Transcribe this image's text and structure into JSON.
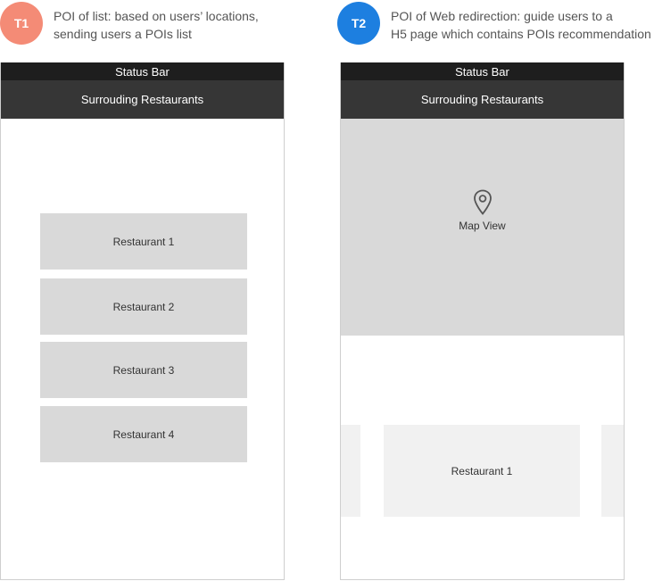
{
  "t1": {
    "badge": "T1",
    "description_line1": "POI of list: based on users’ locations,",
    "description_line2": "sending users a POIs list",
    "badge_color": "#f48b76"
  },
  "t2": {
    "badge": "T2",
    "description_line1": "POI of Web redirection: guide users to a",
    "description_line2": "H5 page which contains POIs recommendation",
    "badge_color": "#1d7fe0"
  },
  "phone1": {
    "status_bar": "Status Bar",
    "nav_title": "Surrouding Restaurants",
    "restaurants": [
      "Restaurant 1",
      "Restaurant 2",
      "Restaurant 3",
      "Restaurant 4"
    ]
  },
  "phone2": {
    "status_bar": "Status Bar",
    "nav_title": "Surrouding Restaurants",
    "map_label": "Map View",
    "map_icon": "map-pin-icon",
    "carousel_card": "Restaurant 1"
  }
}
